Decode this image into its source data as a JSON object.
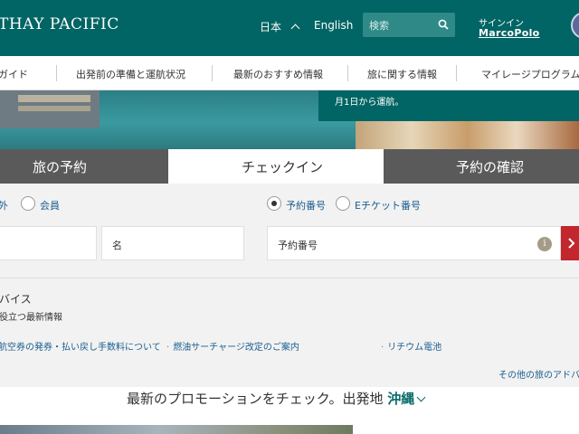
{
  "header": {
    "logo": "THAY PACIFIC",
    "language": "日本",
    "english": "English",
    "search_placeholder": "検索",
    "signin_label": "サインイン",
    "marcopolo": "MarcoPolo"
  },
  "nav": {
    "items": [
      "ガイド",
      "出発前の準備と運航状況",
      "最新のおすすめ情報",
      "旅に関する情報",
      "マイレージプログラム"
    ]
  },
  "hero": {
    "promo_text": "月1日から運航。"
  },
  "tabs": [
    "旅の予約",
    "チェックイン",
    "予約の確認"
  ],
  "form": {
    "radio_left_label": "外",
    "radio_member": "会員",
    "radio_booking": "予約番号",
    "radio_eticket": "Eチケット番号",
    "field_name": "名",
    "field_booking": "予約番号",
    "info_symbol": "i"
  },
  "advisory": {
    "title": "バイス",
    "subtitle": "役立つ最新情報",
    "links": [
      "航空券の発券・払い戻し手数料について",
      "燃油サーチャージ改定のご案内",
      "リチウム電池"
    ],
    "more": "その他の旅のアドバ"
  },
  "promotion": {
    "headline": "最新のプロモーションをチェック。出発地",
    "location": "沖縄"
  },
  "colors": {
    "brand_teal": "#006564",
    "tab_dark": "#5a5a5a",
    "link_blue": "#1a5e8f",
    "go_red": "#c1272d"
  }
}
